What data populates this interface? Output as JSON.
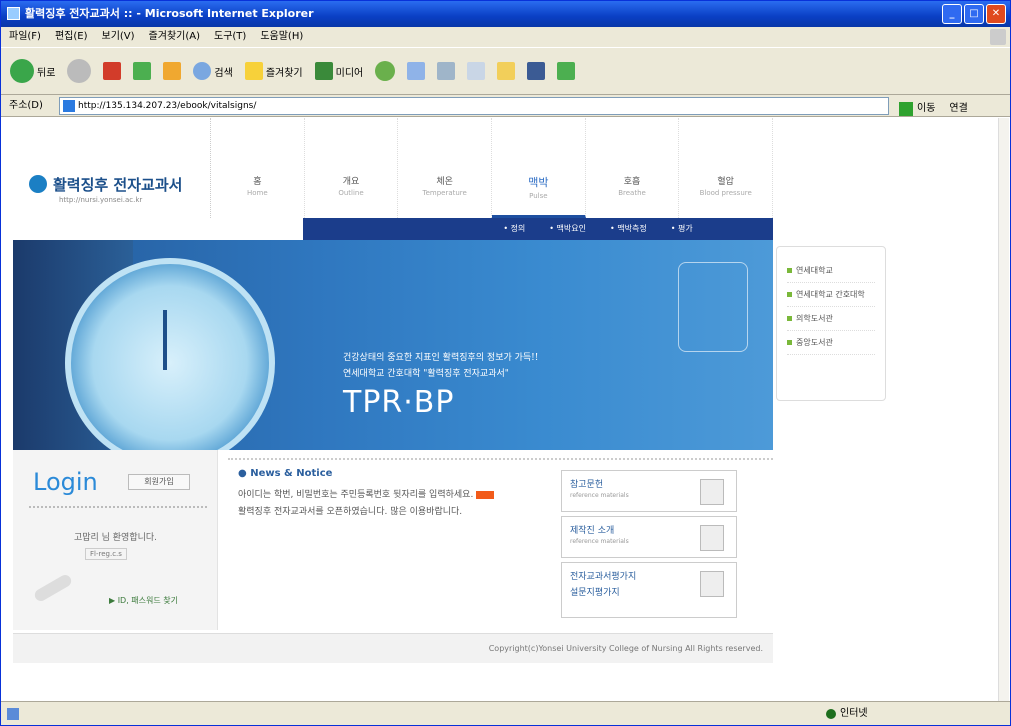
{
  "window": {
    "title": "활력징후 전자교과서 :: - Microsoft Internet Explorer"
  },
  "menu": [
    "파일(F)",
    "편집(E)",
    "보기(V)",
    "즐겨찾기(A)",
    "도구(T)",
    "도움말(H)"
  ],
  "toolbar": {
    "back": "뒤로",
    "search": "검색",
    "favorites": "즐겨찾기",
    "media": "미디어"
  },
  "address": {
    "label": "주소(D)",
    "url": "http://135.134.207.23/ebook/vitalsigns/",
    "go": "이동",
    "links": "연결"
  },
  "status": {
    "zone": "인터넷"
  },
  "site": {
    "logo_text": "활력징후 전자교과서",
    "logo_url": "http://nursi.yonsei.ac.kr",
    "nav": [
      {
        "ko": "홈",
        "en": "Home"
      },
      {
        "ko": "개요",
        "en": "Outline"
      },
      {
        "ko": "체온",
        "en": "Temperature"
      },
      {
        "ko": "맥박",
        "en": "Pulse"
      },
      {
        "ko": "호흡",
        "en": "Breathe"
      },
      {
        "ko": "혈압",
        "en": "Blood pressure"
      }
    ],
    "subnav": [
      "• 정의",
      "• 맥박요인",
      "• 맥박측정",
      "• 평가"
    ],
    "hero": {
      "line1": "건강상태의 중요한 지표인 활력징후의 정보가 가득!!",
      "line2": "연세대학교 간호대학 \"활력징후 전자교과서\"",
      "title": "TPR·BP"
    },
    "side_links": [
      "연세대학교",
      "연세대학교 간호대학",
      "의학도서관",
      "중앙도서관"
    ],
    "login": {
      "title": "Login",
      "button": "회원가입",
      "message": "고맙리 님 환영합니다.",
      "tag": "Fl-reg.c.s",
      "find": "▶ ID, 패스워드 찾기"
    },
    "news": {
      "heading": "News & Notice",
      "items": [
        "아이디는 학번, 비밀번호는 주민등록번호 뒷자리를 입력하세요.",
        "활력징후 전자교과서를 오픈하였습니다. 많은 이용바랍니다."
      ]
    },
    "boxes": [
      {
        "title": "참고문헌",
        "sub": "reference materials"
      },
      {
        "title": "제작진 소개",
        "sub": "reference materials"
      }
    ],
    "box_tall": [
      "전자교과서평가지",
      "설문지평가지"
    ],
    "copyright": "Copyright(c)Yonsei University College of Nursing All Rights reserved."
  }
}
